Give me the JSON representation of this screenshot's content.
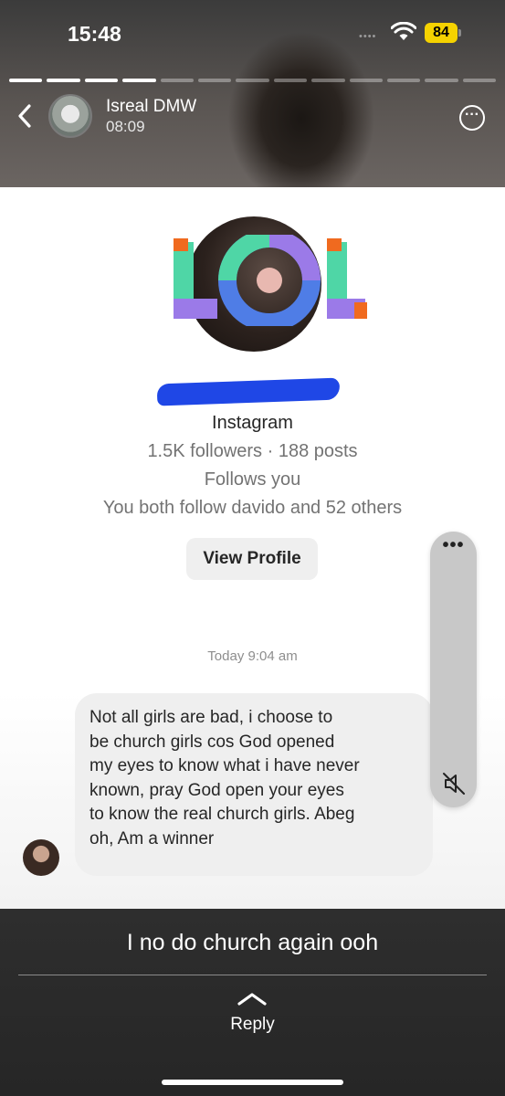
{
  "status_bar": {
    "time": "15:48",
    "signal": "••••",
    "battery": "84"
  },
  "story": {
    "progress": {
      "total_segments": 13,
      "completed_segments": 4
    },
    "user_name": "Isreal DMW",
    "posted_time": "08:09",
    "caption": "I no do church again ooh",
    "reply_label": "Reply"
  },
  "screenshot": {
    "logo_text": "LOL",
    "platform": "Instagram",
    "stats": "1.5K followers · 188 posts",
    "follows_you": "Follows you",
    "mutual": "You both follow davido and 52 others",
    "view_profile_label": "View Profile",
    "timestamp": "Today 9:04 am",
    "message_lines": [
      "Not all girls are bad, i choose  to",
      "be church girls cos God opened",
      "my eyes to know what i have never",
      "known, pray God open your eyes",
      "to know the real church girls. Abeg",
      "oh, Am a winner"
    ]
  },
  "media_controls": {
    "menu": "•••",
    "mute_icon": "speaker-muted-icon"
  },
  "colors": {
    "battery": "#f5d200",
    "redaction": "#1f47e6",
    "bubble": "#efefef"
  }
}
